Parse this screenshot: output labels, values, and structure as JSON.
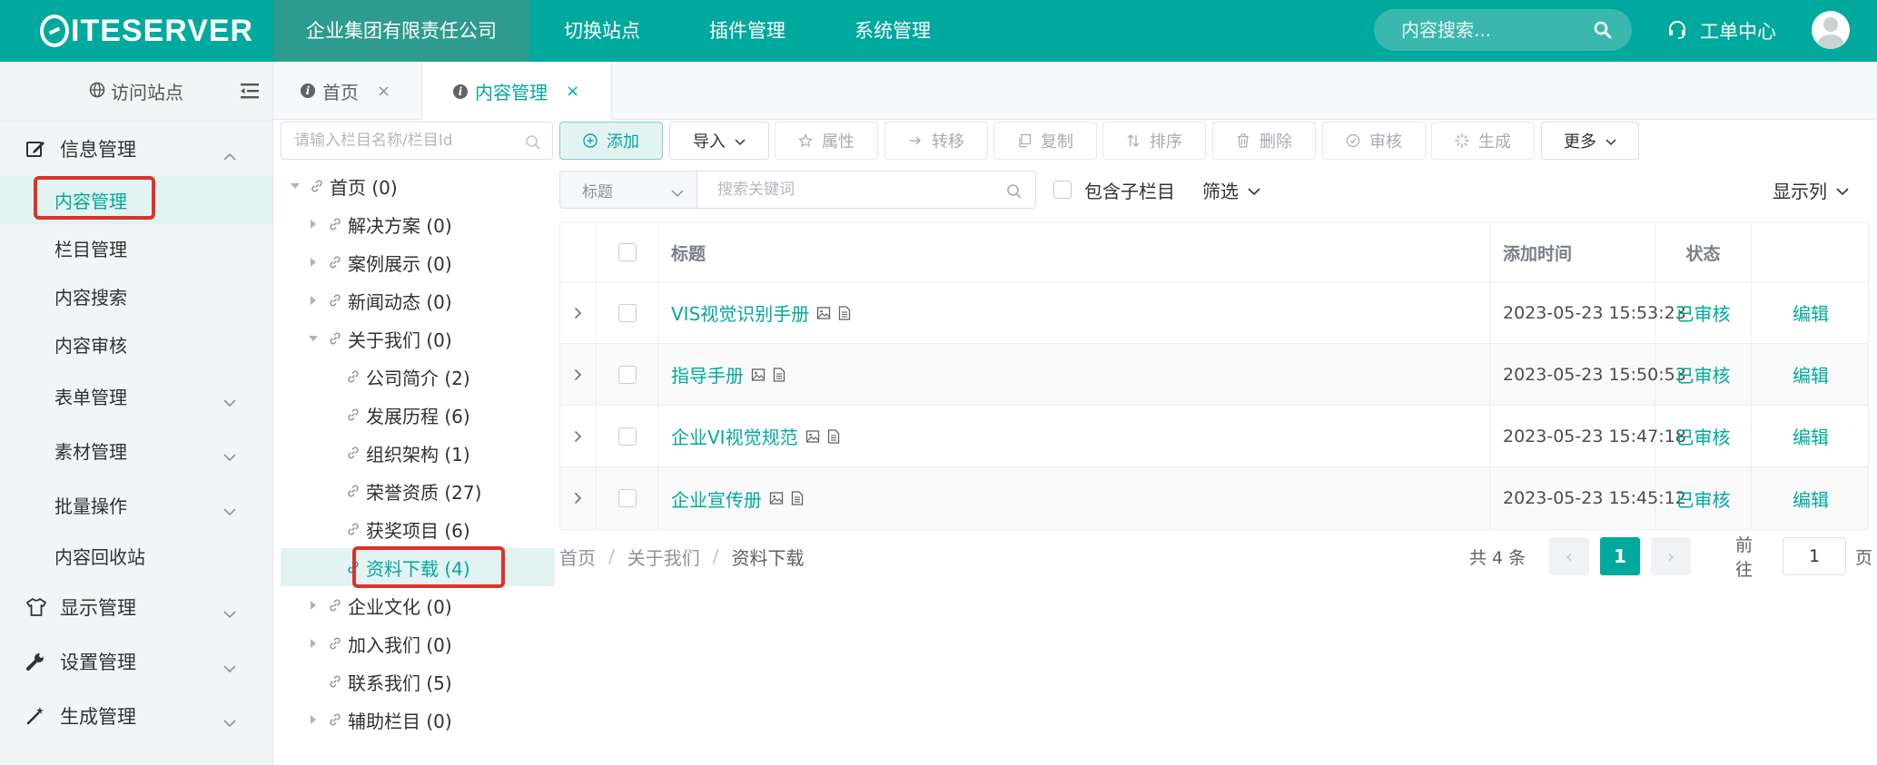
{
  "app": {
    "logo_text": "ITESERVER"
  },
  "topnav": {
    "items": [
      {
        "label": "企业集团有限责任公司"
      },
      {
        "label": "切换站点"
      },
      {
        "label": "插件管理"
      },
      {
        "label": "系统管理"
      }
    ],
    "search_placeholder": "内容搜索...",
    "ticket_label": "工单中心"
  },
  "sidebar": {
    "visit_label": "访问站点",
    "groups": {
      "info": "信息管理",
      "display": "显示管理",
      "settings": "设置管理",
      "generate": "生成管理"
    },
    "info_items": {
      "content": "内容管理",
      "channel": "栏目管理",
      "search": "内容搜索",
      "review": "内容审核",
      "form": "表单管理",
      "material": "素材管理",
      "batch": "批量操作",
      "recycle": "内容回收站"
    }
  },
  "tabs": [
    {
      "label": "首页",
      "close": "×"
    },
    {
      "label": "内容管理",
      "close": "×"
    }
  ],
  "tree": {
    "search_placeholder": "请输入栏目名称/栏目Id",
    "nodes": [
      {
        "label": "首页 (0)"
      },
      {
        "label": "解决方案 (0)"
      },
      {
        "label": "案例展示 (0)"
      },
      {
        "label": "新闻动态 (0)"
      },
      {
        "label": "关于我们 (0)"
      },
      {
        "label": "公司简介 (2)"
      },
      {
        "label": "发展历程 (6)"
      },
      {
        "label": "组织架构 (1)"
      },
      {
        "label": "荣誉资质 (27)"
      },
      {
        "label": "获奖项目 (6)"
      },
      {
        "label": "资料下载 (4)"
      },
      {
        "label": "企业文化 (0)"
      },
      {
        "label": "加入我们 (0)"
      },
      {
        "label": "联系我们 (5)"
      },
      {
        "label": "辅助栏目 (0)"
      }
    ]
  },
  "toolbar": {
    "add": "添加",
    "import": "导入",
    "attr": "属性",
    "move": "转移",
    "copy": "复制",
    "sort": "排序",
    "delete": "删除",
    "review": "审核",
    "generate": "生成",
    "more": "更多"
  },
  "filter": {
    "field": "标题",
    "keyword_placeholder": "搜索关键词",
    "include_sub": "包含子栏目",
    "filter_label": "筛选",
    "columns_label": "显示列"
  },
  "table": {
    "headers": {
      "title": "标题",
      "time": "添加时间",
      "status": "状态"
    },
    "rows": [
      {
        "title": "VIS视觉识别手册",
        "time": "2023-05-23 15:53:23",
        "status": "已审核",
        "action": "编辑"
      },
      {
        "title": "指导手册",
        "time": "2023-05-23 15:50:53",
        "status": "已审核",
        "action": "编辑"
      },
      {
        "title": "企业VI视觉规范",
        "time": "2023-05-23 15:47:18",
        "status": "已审核",
        "action": "编辑"
      },
      {
        "title": "企业宣传册",
        "time": "2023-05-23 15:45:12",
        "status": "已审核",
        "action": "编辑"
      }
    ]
  },
  "breadcrumb": {
    "items": [
      "首页",
      "关于我们",
      "资料下载"
    ],
    "sep": "/"
  },
  "pagination": {
    "total": "共 4 条",
    "prev": "‹",
    "current": "1",
    "next": "›",
    "goto_label": "前往",
    "goto_value": "1",
    "page_unit": "页"
  },
  "colors": {
    "brand": "#00a99d",
    "highlight_box": "#e0302c"
  }
}
